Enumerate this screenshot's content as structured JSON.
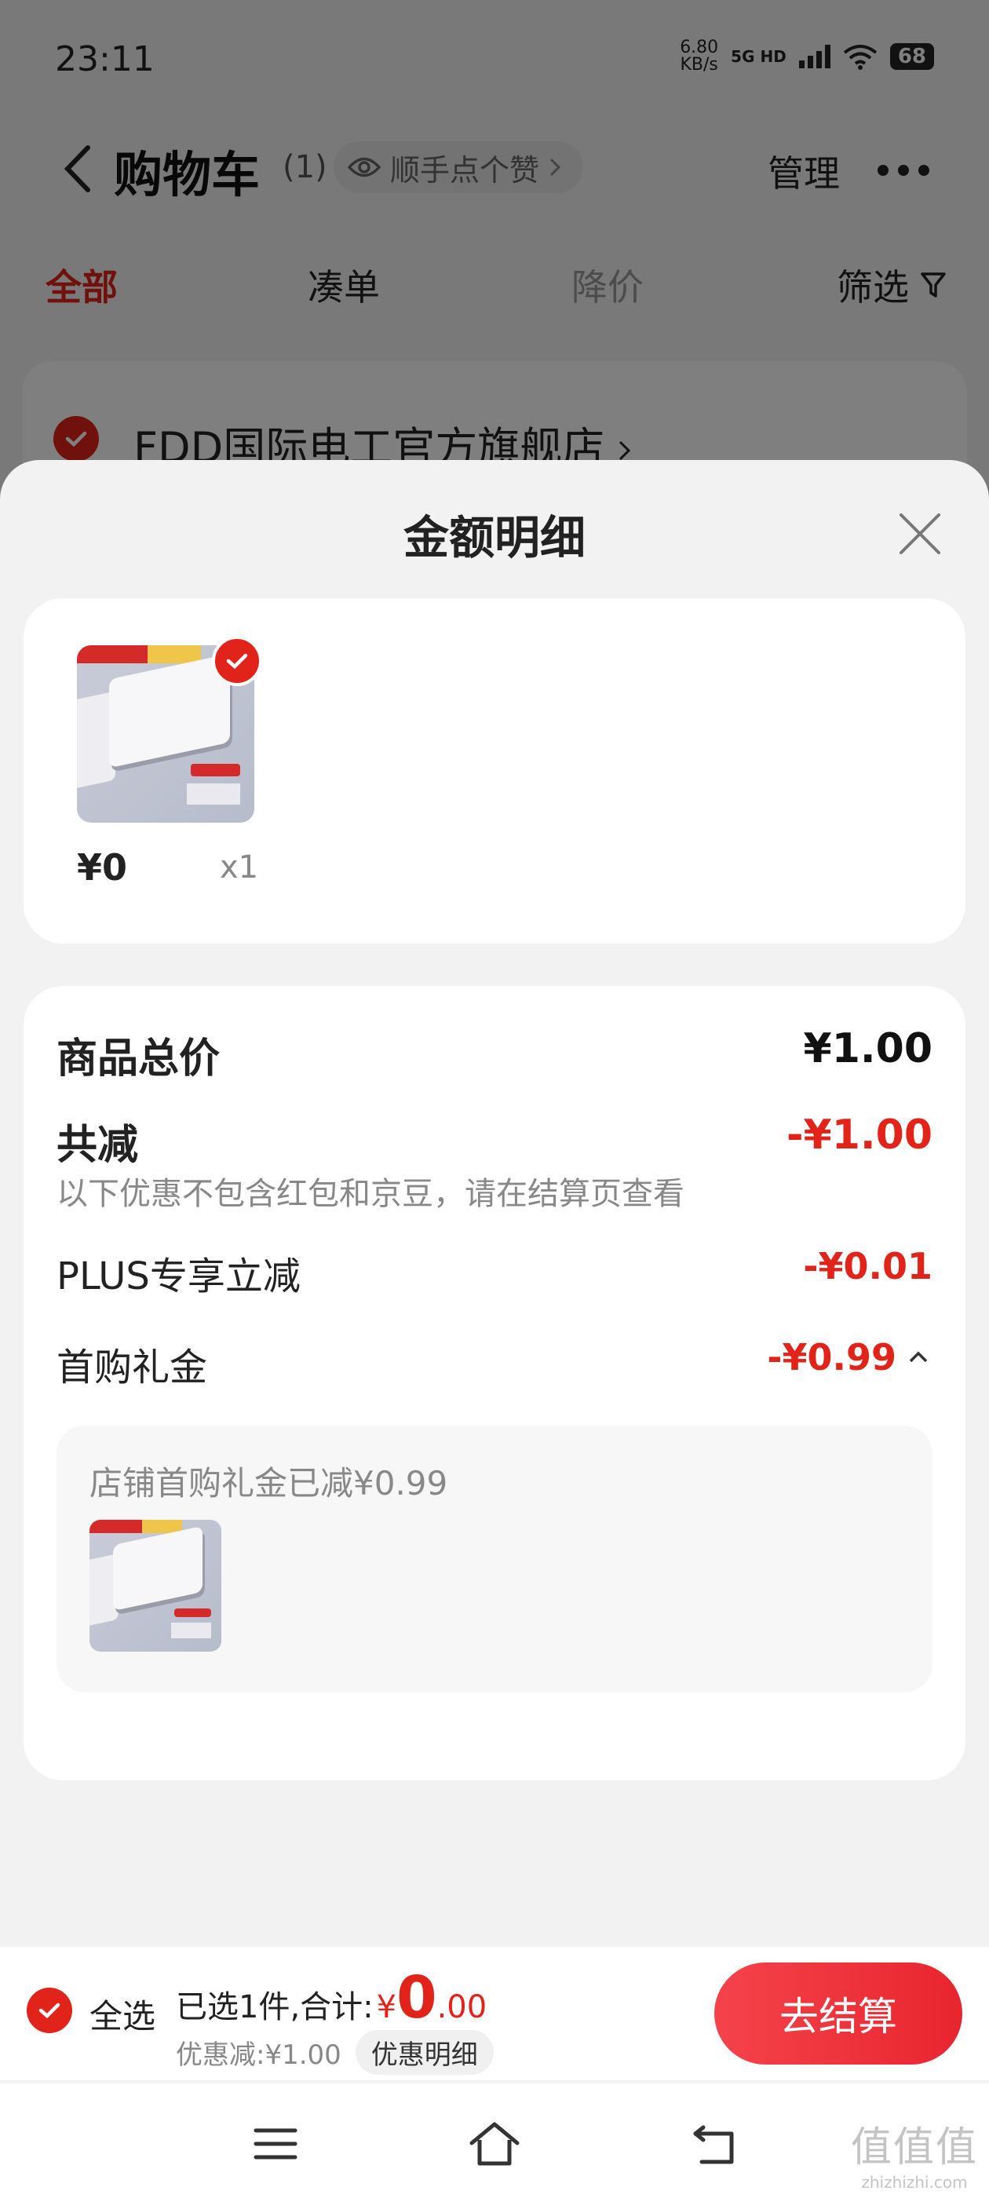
{
  "status_bar": {
    "time": "23:11",
    "speed_value": "6.80",
    "speed_unit": "KB/s",
    "network": "5G HD",
    "battery": "68"
  },
  "nav": {
    "title": "购物车",
    "count": "(1)",
    "like_label": "顺手点个赞",
    "manage": "管理"
  },
  "tabs": [
    {
      "label": "全部"
    },
    {
      "label": "凑单"
    },
    {
      "label": "降价"
    },
    {
      "label": "筛选"
    }
  ],
  "store": {
    "name": "FDD国际电工官方旗舰店"
  },
  "sheet": {
    "title": "金额明细",
    "item": {
      "price": "¥0",
      "quantity": "x1"
    },
    "rows": {
      "total": {
        "label": "商品总价",
        "value": "¥1.00"
      },
      "reduce": {
        "label": "共减",
        "value": "-¥1.00",
        "note": "以下优惠不包含红包和京豆，请在结算页查看"
      },
      "plus": {
        "label": "PLUS专享立减",
        "value": "-¥0.01"
      },
      "gift": {
        "label": "首购礼金",
        "value": "-¥0.99"
      }
    },
    "gift_detail": {
      "text": "店铺首购礼金已减¥0.99"
    }
  },
  "action_bar": {
    "select_all": "全选",
    "selected_text": "已选1件,合计:",
    "currency": "¥",
    "total_int": "0",
    "total_dec": ".00",
    "discount_text": "优惠减:¥1.00",
    "discount_detail": "优惠明细",
    "checkout": "去结算"
  },
  "watermark": {
    "big": "值值值",
    "small": "zhizhizhi.com"
  },
  "colors": {
    "accent": "#e2231a",
    "sheet_bg": "#f2f2f2",
    "card_bg": "#ffffff",
    "overlay": "rgba(0,0,0,0.5)"
  }
}
